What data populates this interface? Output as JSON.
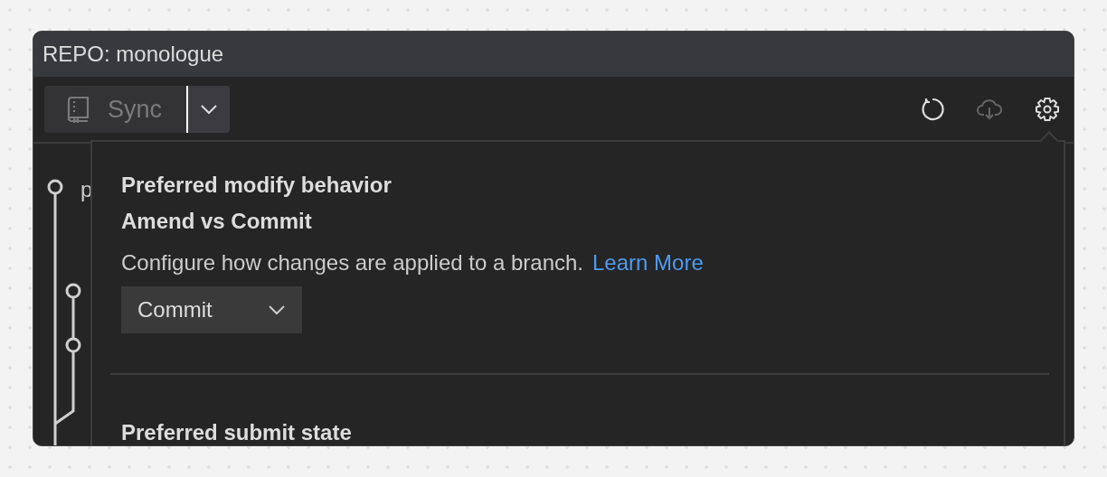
{
  "window": {
    "title": "REPO: monologue"
  },
  "toolbar": {
    "sync_button": {
      "label": "Sync",
      "disabled": true
    }
  },
  "commit_graph": {
    "rows": [
      {
        "label": "p"
      }
    ]
  },
  "settings_popup": {
    "sections": [
      {
        "title": "Preferred modify behavior",
        "subtitle": "Amend vs Commit",
        "description": "Configure how changes are applied to a branch.",
        "link": "Learn More",
        "dropdown": {
          "value": "Commit"
        }
      },
      {
        "title": "Preferred submit state"
      }
    ]
  }
}
